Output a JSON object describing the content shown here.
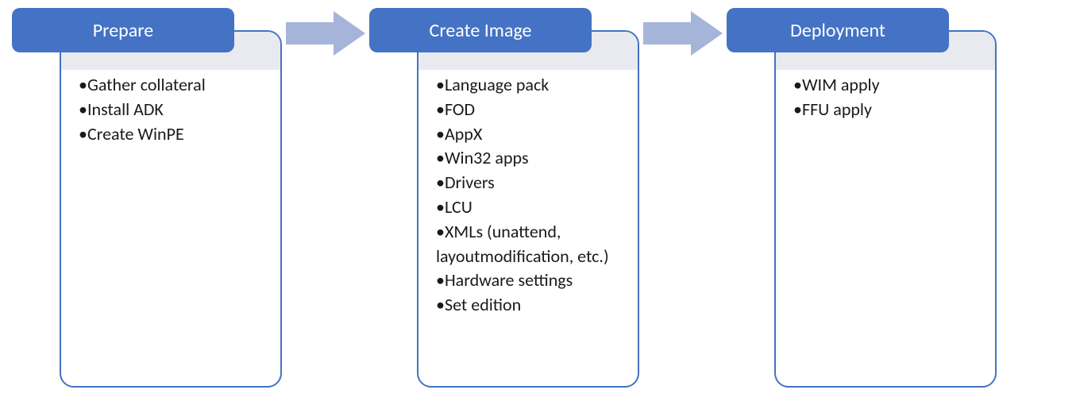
{
  "colors": {
    "header_fill": "#4472c4",
    "arrow_fill": "#a5b4d9",
    "body_border": "#4472c4",
    "overlay_fill": "#e8eaf0",
    "text": "#1a1a1a",
    "header_text": "#ffffff"
  },
  "stages": [
    {
      "title": "Prepare",
      "items": [
        "Gather collateral",
        "Install ADK",
        "Create WinPE"
      ]
    },
    {
      "title": "Create Image",
      "items": [
        "Language pack",
        "FOD",
        "AppX",
        "Win32 apps",
        "Drivers",
        "LCU",
        "XMLs (unattend, layoutmodification, etc.)",
        "Hardware settings",
        "Set edition"
      ]
    },
    {
      "title": "Deployment",
      "items": [
        "WIM apply",
        "FFU apply"
      ]
    }
  ]
}
